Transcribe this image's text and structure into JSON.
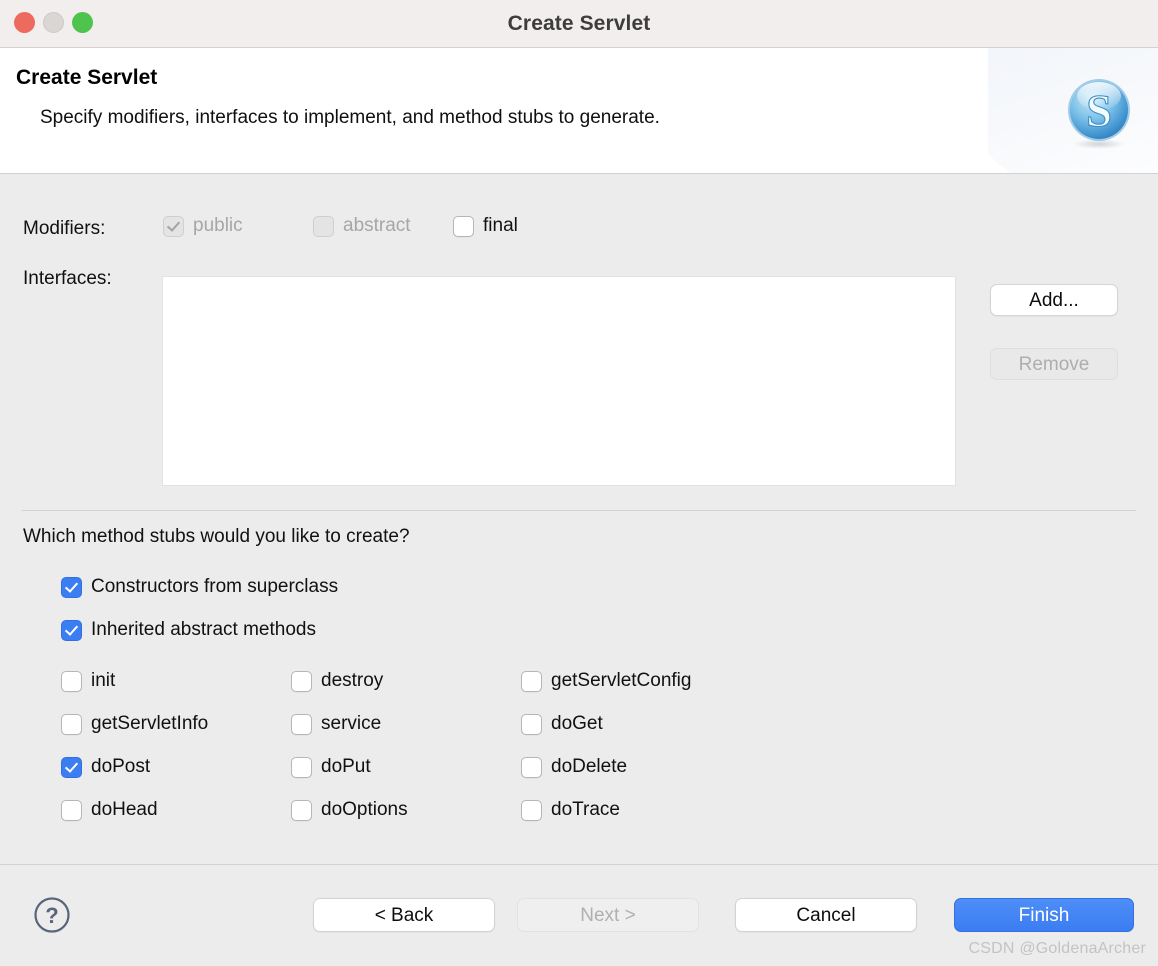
{
  "window": {
    "title": "Create Servlet",
    "controls": [
      {
        "name": "close",
        "color": "#ec6a5e"
      },
      {
        "name": "minimize",
        "color": "#d9d6d4"
      },
      {
        "name": "zoom",
        "color": "#4ec44e"
      }
    ]
  },
  "header": {
    "title": "Create Servlet",
    "description": "Specify modifiers, interfaces to implement, and method stubs to generate.",
    "icon": "servlet-sphere-icon"
  },
  "form": {
    "modifiers_label": "Modifiers:",
    "modifiers": [
      {
        "label": "public",
        "checked": true,
        "enabled": false
      },
      {
        "label": "abstract",
        "checked": false,
        "enabled": false
      },
      {
        "label": "final",
        "checked": false,
        "enabled": true
      }
    ],
    "interfaces_label": "Interfaces:",
    "interfaces_items": [],
    "add_label": "Add...",
    "add_enabled": true,
    "remove_label": "Remove",
    "remove_enabled": false
  },
  "stubs": {
    "question": "Which method stubs would you like to create?",
    "top_options": [
      {
        "label": "Constructors from superclass",
        "checked": true
      },
      {
        "label": "Inherited abstract methods",
        "checked": true
      }
    ],
    "methods": [
      {
        "label": "init",
        "checked": false
      },
      {
        "label": "destroy",
        "checked": false
      },
      {
        "label": "getServletConfig",
        "checked": false
      },
      {
        "label": "getServletInfo",
        "checked": false
      },
      {
        "label": "service",
        "checked": false
      },
      {
        "label": "doGet",
        "checked": false
      },
      {
        "label": "doPost",
        "checked": true
      },
      {
        "label": "doPut",
        "checked": false
      },
      {
        "label": "doDelete",
        "checked": false
      },
      {
        "label": "doHead",
        "checked": false
      },
      {
        "label": "doOptions",
        "checked": false
      },
      {
        "label": "doTrace",
        "checked": false
      }
    ]
  },
  "footer": {
    "help_icon": "question-mark-icon",
    "back_label": "< Back",
    "back_enabled": true,
    "next_label": "Next >",
    "next_enabled": false,
    "cancel_label": "Cancel",
    "cancel_enabled": true,
    "finish_label": "Finish",
    "finish_enabled": true,
    "finish_color": "#3b7df2"
  },
  "watermark": "CSDN @GoldenaArcher"
}
